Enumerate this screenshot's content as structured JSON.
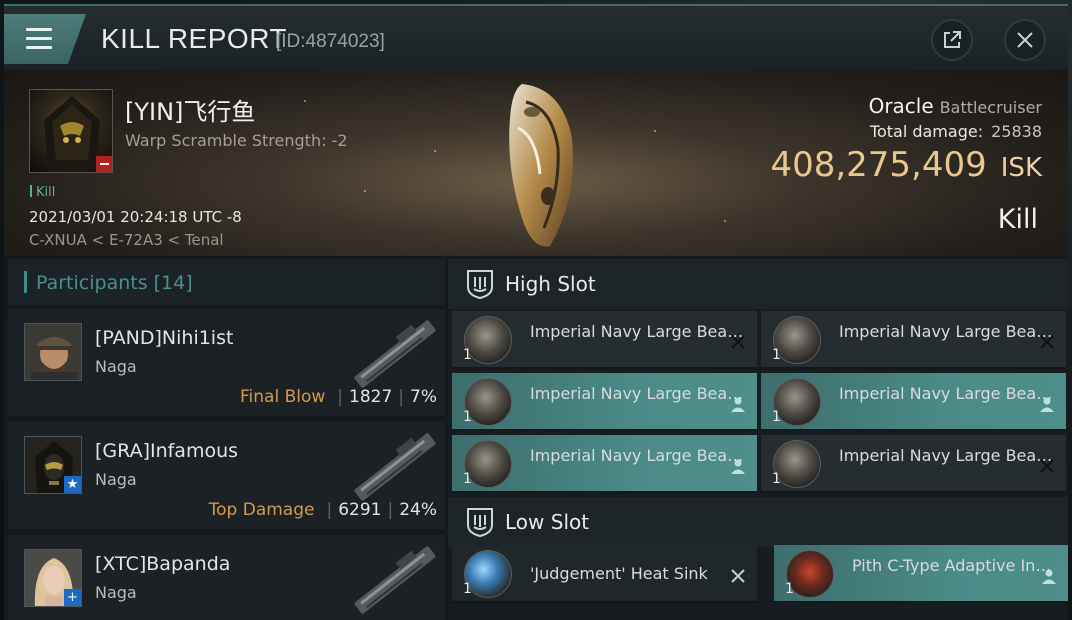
{
  "header": {
    "title": "KILL REPORT",
    "report_id": "[ID:4874023]"
  },
  "victim": {
    "name": "[YIN]飞行鱼",
    "warp_scramble": "Warp Scramble Strength: -2",
    "tag": "Kill",
    "timestamp": "2021/03/01 20:24:18 UTC -8",
    "location": "C-XNUA < E-72A3 < Tenal",
    "ship": "Oracle",
    "ship_class": "Battlecruiser",
    "total_damage_label": "Total damage:",
    "total_damage": "25838",
    "isk_value": "408,275,409",
    "isk_unit": "ISK",
    "result": "Kill"
  },
  "participants": {
    "label": "Participants [14]",
    "rows": [
      {
        "name": "[PAND]Nihi1ist",
        "ship": "Naga",
        "role": "Final Blow",
        "damage": "1827",
        "percent": "7%",
        "corp_badge": ""
      },
      {
        "name": "[GRA]Infamous",
        "ship": "Naga",
        "role": "Top Damage",
        "damage": "6291",
        "percent": "24%",
        "corp_badge": "★"
      },
      {
        "name": "[XTC]Bapanda",
        "ship": "Naga",
        "role": "",
        "damage": "",
        "percent": "",
        "corp_badge": "+"
      }
    ]
  },
  "high_slot": {
    "title": "High Slot",
    "modules": [
      {
        "name": "Imperial Navy Large Beam Laser",
        "qty": "1",
        "state": "destroyed",
        "action_icon": "x-icon"
      },
      {
        "name": "Imperial Navy Large Beam Laser",
        "qty": "1",
        "state": "destroyed",
        "action_icon": "x-icon"
      },
      {
        "name": "Imperial Navy Large Beam Laser",
        "qty": "1",
        "state": "dropped",
        "action_icon": "person-icon"
      },
      {
        "name": "Imperial Navy Large Beam Laser",
        "qty": "1",
        "state": "dropped",
        "action_icon": "person-icon"
      },
      {
        "name": "Imperial Navy Large Beam Laser",
        "qty": "1",
        "state": "dropped",
        "action_icon": "person-icon"
      },
      {
        "name": "Imperial Navy Large Beam Laser",
        "qty": "1",
        "state": "destroyed",
        "action_icon": "x-icon"
      }
    ]
  },
  "low_slot": {
    "title": "Low Slot",
    "modules": [
      {
        "name": "'Judgement' Heat Sink",
        "qty": "1",
        "state": "destroyed",
        "action_icon": "x-icon"
      },
      {
        "name": "Pith C-Type Adaptive Invulnerability Field",
        "qty": "1",
        "state": "dropped",
        "action_icon": "person-icon"
      }
    ]
  },
  "colors": {
    "accent_teal": "#4b8a87",
    "isk_gold": "#e9c88f",
    "role_orange": "#d29b4d"
  }
}
